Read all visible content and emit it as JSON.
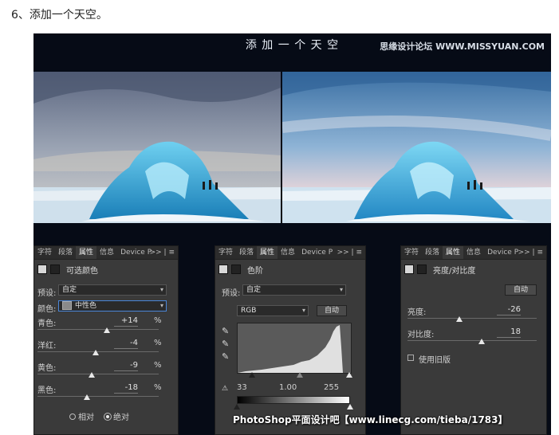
{
  "heading": "6、添加一个天空。",
  "banner_title": "添 加 一 个 天 空",
  "watermark": "思缘设计论坛 WWW.MISSYUAN.COM",
  "tabs": [
    "字符",
    "段落",
    "属性",
    "信息",
    "Device P"
  ],
  "tabs_menu": ">> | ≡",
  "panel_left": {
    "header": "可选颜色",
    "preset_label": "预设:",
    "preset_value": "自定",
    "color_label": "颜色:",
    "color_value": "中性色",
    "sliders": [
      {
        "label": "青色:",
        "value": "+14",
        "unit": "%",
        "pos": 0.57
      },
      {
        "label": "洋红:",
        "value": "-4",
        "unit": "%",
        "pos": 0.48
      },
      {
        "label": "黄色:",
        "value": "-9",
        "unit": "%",
        "pos": 0.45
      },
      {
        "label": "黑色:",
        "value": "-18",
        "unit": "%",
        "pos": 0.41
      }
    ],
    "radio_relative": "相对",
    "radio_absolute": "绝对"
  },
  "panel_middle": {
    "header": "色阶",
    "preset_label": "预设:",
    "preset_value": "自定",
    "channel": "RGB",
    "auto_button": "自动",
    "input_black": "33",
    "input_gamma": "1.00",
    "input_white": "255"
  },
  "panel_right": {
    "header": "亮度/对比度",
    "auto_button": "自动",
    "brightness_label": "亮度:",
    "brightness_value": "-26",
    "brightness_pos": 0.45,
    "contrast_label": "对比度:",
    "contrast_value": "18",
    "contrast_pos": 0.56,
    "legacy_label": "使用旧版"
  },
  "credit": "PhotoShop平面设计吧【www.linecg.com/tieba/1783】"
}
